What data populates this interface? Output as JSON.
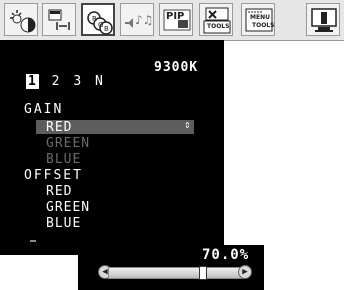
{
  "toolbar": {
    "items": [
      {
        "icon": "brightness-contrast-icon"
      },
      {
        "icon": "size-position-icon"
      },
      {
        "icon": "color-control-icon",
        "active": true
      },
      {
        "icon": "audio-icon"
      },
      {
        "icon": "pip-icon",
        "label": "PIP"
      },
      {
        "icon": "tools-icon",
        "label": "TOOLS"
      },
      {
        "icon": "menu-tools-icon",
        "label_top": "MENU",
        "label_bottom": "TOOLS"
      },
      {
        "icon": "information-icon",
        "label": "i"
      }
    ]
  },
  "osd": {
    "preset": "9300K",
    "modes": [
      "1",
      "2",
      "3",
      "N"
    ],
    "selected_mode": "1",
    "gain": {
      "title": "GAIN",
      "items": [
        "RED",
        "GREEN",
        "BLUE"
      ],
      "selected": "RED"
    },
    "offset": {
      "title": "OFFSET",
      "items": [
        "RED",
        "GREEN",
        "BLUE"
      ]
    },
    "selector_glyph": "⇕"
  },
  "value": {
    "percent_label": "70.0%",
    "level": 0.7
  },
  "colors": {
    "panel": "#000000",
    "highlight": "#5d5d5d",
    "dim_text": "#6a6a6a"
  }
}
